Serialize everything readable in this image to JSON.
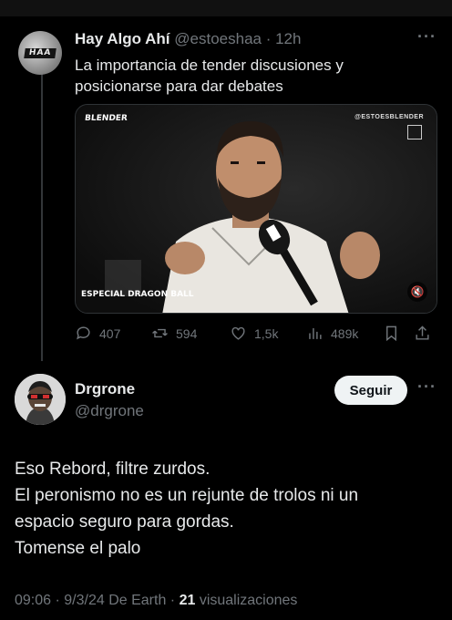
{
  "tweet1": {
    "avatar_logo_text": "HAA",
    "name": "Hay Algo Ahí",
    "handle": "@estoeshaa",
    "time": "12h",
    "text_lines": [
      "La importancia de tender discusiones y",
      "posicionarse para dar debates"
    ],
    "video": {
      "brand": "BLENDER",
      "handle": "@ESTOESBLENDER",
      "caption": "ESPECIAL DRAGON BALL"
    },
    "actions": {
      "replies": "407",
      "retweets": "594",
      "likes": "1,5k",
      "views": "489k"
    }
  },
  "tweet2": {
    "name": "Drgrone",
    "handle": "@drgrone",
    "follow_label": "Seguir",
    "text_lines": [
      "Eso Rebord, filtre zurdos.",
      "El peronismo no es un rejunte de trolos ni un",
      "espacio seguro para gordas.",
      "Tomense el palo"
    ],
    "meta": {
      "time": "09:06",
      "date": "9/3/24",
      "source": "De Earth",
      "views_count": "21",
      "views_label": "visualizaciones"
    }
  },
  "colors": {
    "background": "#000000",
    "text": "#e7e9ea",
    "secondary": "#71767b",
    "follow_bg": "#eff3f4"
  }
}
